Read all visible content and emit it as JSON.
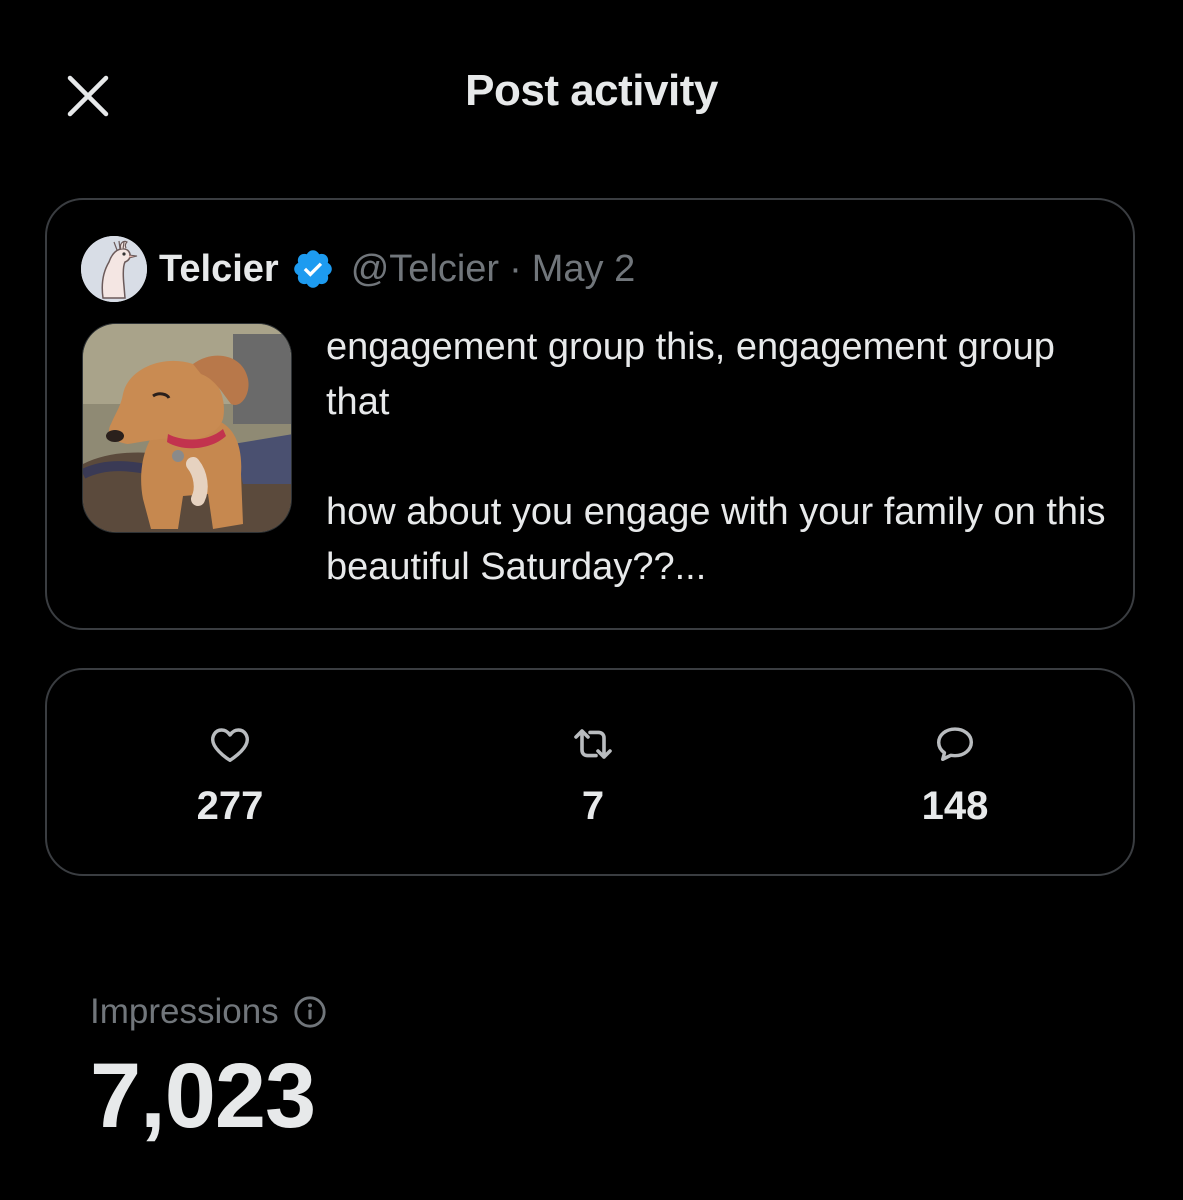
{
  "header": {
    "title": "Post activity",
    "close_icon": "close-icon"
  },
  "post": {
    "author_name": "Telcier",
    "verified_icon": "verified-badge-icon",
    "handle": "@Telcier",
    "separator": "·",
    "date": "May 2",
    "text_line_1": "engagement group this, engagement group that",
    "text_line_2": "how about you engage with your family on this beautiful Saturday??...",
    "thumbnail": "dog-photo"
  },
  "metrics": {
    "likes": {
      "icon": "heart-icon",
      "count": "277"
    },
    "reposts": {
      "icon": "repost-icon",
      "count": "7"
    },
    "replies": {
      "icon": "reply-icon",
      "count": "148"
    }
  },
  "impressions": {
    "label": "Impressions",
    "info_icon": "info-icon",
    "value": "7,023"
  },
  "colors": {
    "background": "#000000",
    "primary_text": "#e7e9ea",
    "secondary_text": "#71767b",
    "border": "#3a3d41",
    "verified_blue": "#1d9bf0"
  }
}
